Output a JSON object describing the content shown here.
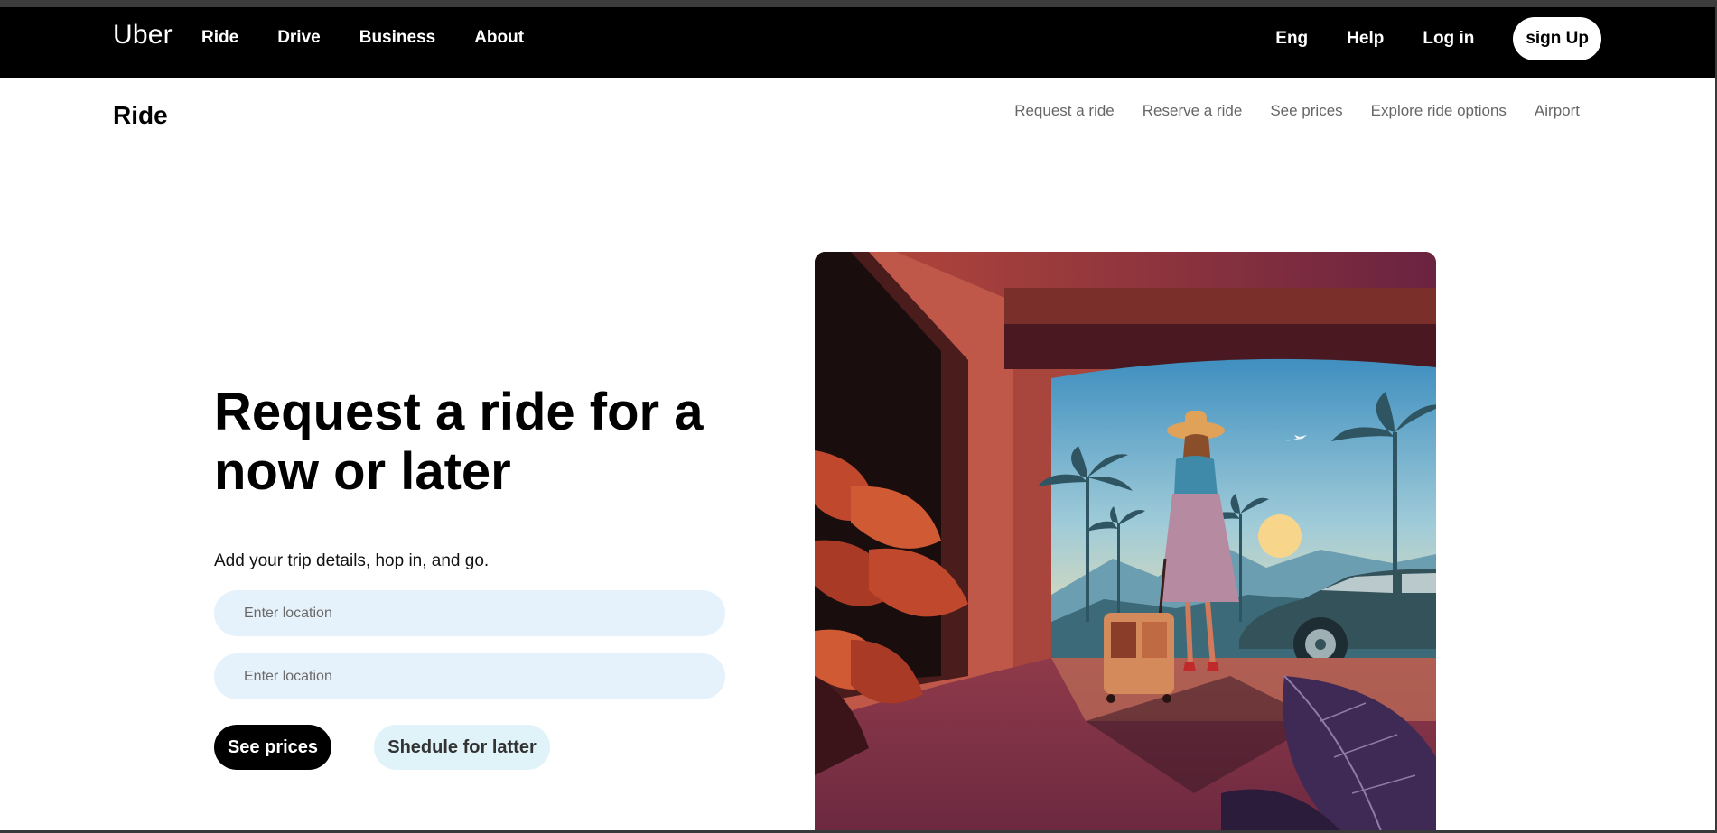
{
  "brand": {
    "logo": "Uber"
  },
  "topnav": {
    "left_links": [
      "Ride",
      "Drive",
      "Business",
      "About"
    ],
    "right_links": [
      "Eng",
      "Help",
      "Log in"
    ],
    "signup_label": "sign Up"
  },
  "subnav": {
    "title": "Ride",
    "links": [
      "Request a ride",
      "Reserve a ride",
      "See prices",
      "Explore ride options",
      "Airport"
    ]
  },
  "hero": {
    "title": "Request a ride for a now or later",
    "subtitle": "Add your trip details, hop in, and go.",
    "pickup_placeholder": "Enter location",
    "dropoff_placeholder": "Enter location",
    "see_prices_label": "See prices",
    "schedule_label": "Shedule for latter"
  },
  "illustration": {
    "icon": "travel-illustration"
  },
  "colors": {
    "nav_bg": "#000000",
    "input_bg": "#e6f2fb",
    "schedule_bg": "#dff3f8",
    "subnav_link": "#666666"
  }
}
